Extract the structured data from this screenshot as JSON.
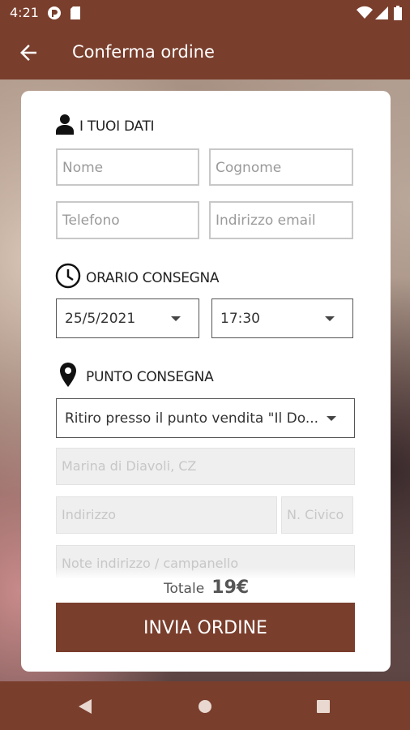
{
  "status": {
    "time": "4:21"
  },
  "appbar": {
    "title": "Conferma ordine"
  },
  "sections": {
    "personal": "I TUOI DATI",
    "time": "ORARIO CONSEGNA",
    "point": "PUNTO CONSEGNA"
  },
  "fields": {
    "nome": "Nome",
    "cognome": "Cognome",
    "telefono": "Telefono",
    "email": "Indirizzo email",
    "citta": "Marina di Diavoli, CZ",
    "indirizzo": "Indirizzo",
    "civico": "N. Civico",
    "note": "Note indirizzo / campanello"
  },
  "selects": {
    "date": "25/5/2021",
    "hour": "17:30",
    "delivery": "Ritiro presso il punto vendita \"Il Do..."
  },
  "total": {
    "label": "Totale",
    "value": "19€"
  },
  "submit": {
    "label": "INVIA ORDINE"
  },
  "icons": [
    "back-arrow-icon",
    "person-icon",
    "clock-icon",
    "map-pin-icon",
    "back-nav-icon",
    "home-nav-icon",
    "recents-nav-icon",
    "wifi-icon",
    "signal-icon",
    "battery-icon"
  ]
}
